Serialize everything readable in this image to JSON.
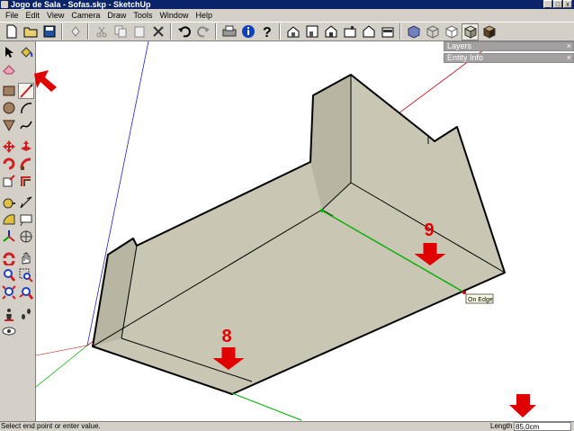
{
  "window": {
    "title": "Jogo de Sala - Sofas.skp - SketchUp",
    "controls": {
      "minimize": "_",
      "maximize": "□",
      "close": "x"
    }
  },
  "menu": [
    "File",
    "Edit",
    "View",
    "Camera",
    "Draw",
    "Tools",
    "Window",
    "Help"
  ],
  "toolbar": {
    "icons": [
      "new-icon",
      "open-icon",
      "save-icon",
      "make-component-icon",
      "cut-icon",
      "copy-icon",
      "paste-icon",
      "erase-icon",
      "undo-icon",
      "redo-icon",
      "print-icon",
      "model-info-icon",
      "help-icon",
      "iso-view-icon",
      "top-view-icon",
      "front-view-icon",
      "right-view-icon",
      "back-view-icon",
      "left-view-icon",
      "xray-icon",
      "wireframe-icon",
      "hidden-line-icon",
      "shaded-icon",
      "shaded-textures-icon"
    ],
    "active_icon": "shaded-icon"
  },
  "left_toolbar": {
    "icons": [
      "select-icon",
      "paint-bucket-icon",
      "eraser-icon",
      "rectangle-icon",
      "line-icon",
      "circle-icon",
      "arc-icon",
      "polygon-icon",
      "freehand-icon",
      "move-icon",
      "push-pull-icon",
      "rotate-icon",
      "follow-me-icon",
      "scale-icon",
      "offset-icon",
      "tape-measure-icon",
      "dimension-icon",
      "protractor-icon",
      "text-icon",
      "axes-icon",
      "3d-text-icon",
      "orbit-icon",
      "pan-icon",
      "zoom-icon",
      "zoom-window-icon",
      "zoom-extents-icon",
      "previous-view-icon",
      "walk-icon",
      "position-camera-icon",
      "look-around-icon"
    ],
    "active_icon": "line-icon"
  },
  "trays": [
    {
      "label": "Layers"
    },
    {
      "label": "Entity Info"
    }
  ],
  "viewport": {
    "inference_tooltip": "On Edge",
    "callouts": [
      "8",
      "9"
    ],
    "colors": {
      "face": "#c9c6b4",
      "face_dark": "#b8b5a3",
      "edge": "#000000",
      "red_axis": "#c00000",
      "green_axis": "#00b000",
      "blue_axis": "#2020c0",
      "callout": "#e00000"
    }
  },
  "status": {
    "message": "Select end point or enter value.",
    "vcb_label": "Length",
    "vcb_value": "85,0cm"
  }
}
